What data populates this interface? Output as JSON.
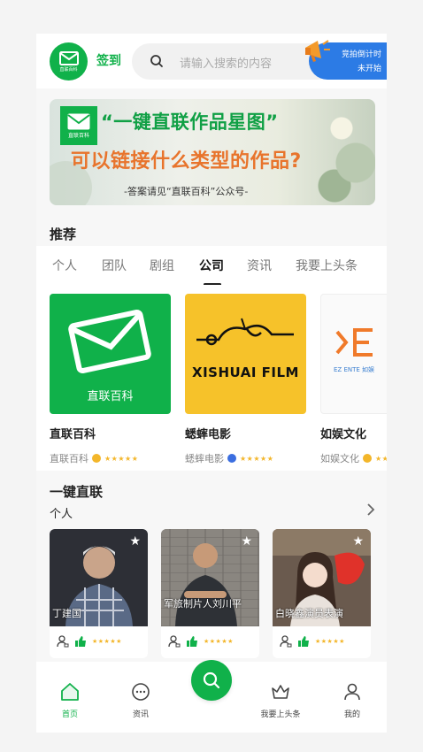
{
  "header": {
    "signin_label": "签到",
    "search_placeholder": "请输入搜索的内容",
    "auction_line1": "竞拍倒计时",
    "auction_line2": "未开始",
    "brand_color": "#10b14a",
    "accent_blue": "#2c7be5"
  },
  "banner": {
    "line1": "“一键直联作品星图”",
    "line2": "可以链接什么类型的作品?",
    "line3": "-答案请见“直联百科”公众号-"
  },
  "recommend": {
    "title": "推荐",
    "tabs": [
      {
        "label": "个人"
      },
      {
        "label": "团队"
      },
      {
        "label": "剧组"
      },
      {
        "label": "公司",
        "active": true
      },
      {
        "label": "资讯"
      },
      {
        "label": "我要上头条"
      }
    ],
    "cards": [
      {
        "name": "直联百科",
        "sub": "直联百科",
        "image_caption": "直联百科",
        "badge_color": "#f3b62a",
        "rating": "★★★★★"
      },
      {
        "name": "蟋蟀电影",
        "sub": "蟋蟀电影",
        "image_caption": "XISHUAI FILM",
        "badge_color": "#3b6ee0",
        "rating": "★★★★★"
      },
      {
        "name": "如娱文化",
        "sub": "如娱文化",
        "image_caption": "EZ ENTE 如娱",
        "badge_color": "#f3b62a",
        "rating": "★★★★★"
      }
    ]
  },
  "one_key": {
    "title": "一键直联",
    "subtitle": "个人",
    "people": [
      {
        "name": "丁建国",
        "rating": "★★★★★"
      },
      {
        "name": "军旅制片人刘川平",
        "rating": "★★★★★"
      },
      {
        "name": "白晓鑫演员表演",
        "rating": "★★★★★"
      }
    ]
  },
  "nav": {
    "items": [
      {
        "label": "首页",
        "icon": "home-icon",
        "active": true
      },
      {
        "label": "资讯",
        "icon": "chat-icon"
      },
      {
        "label": "",
        "icon": "search-icon"
      },
      {
        "label": "我要上头条",
        "icon": "crown-icon"
      },
      {
        "label": "我的",
        "icon": "user-icon"
      }
    ]
  }
}
